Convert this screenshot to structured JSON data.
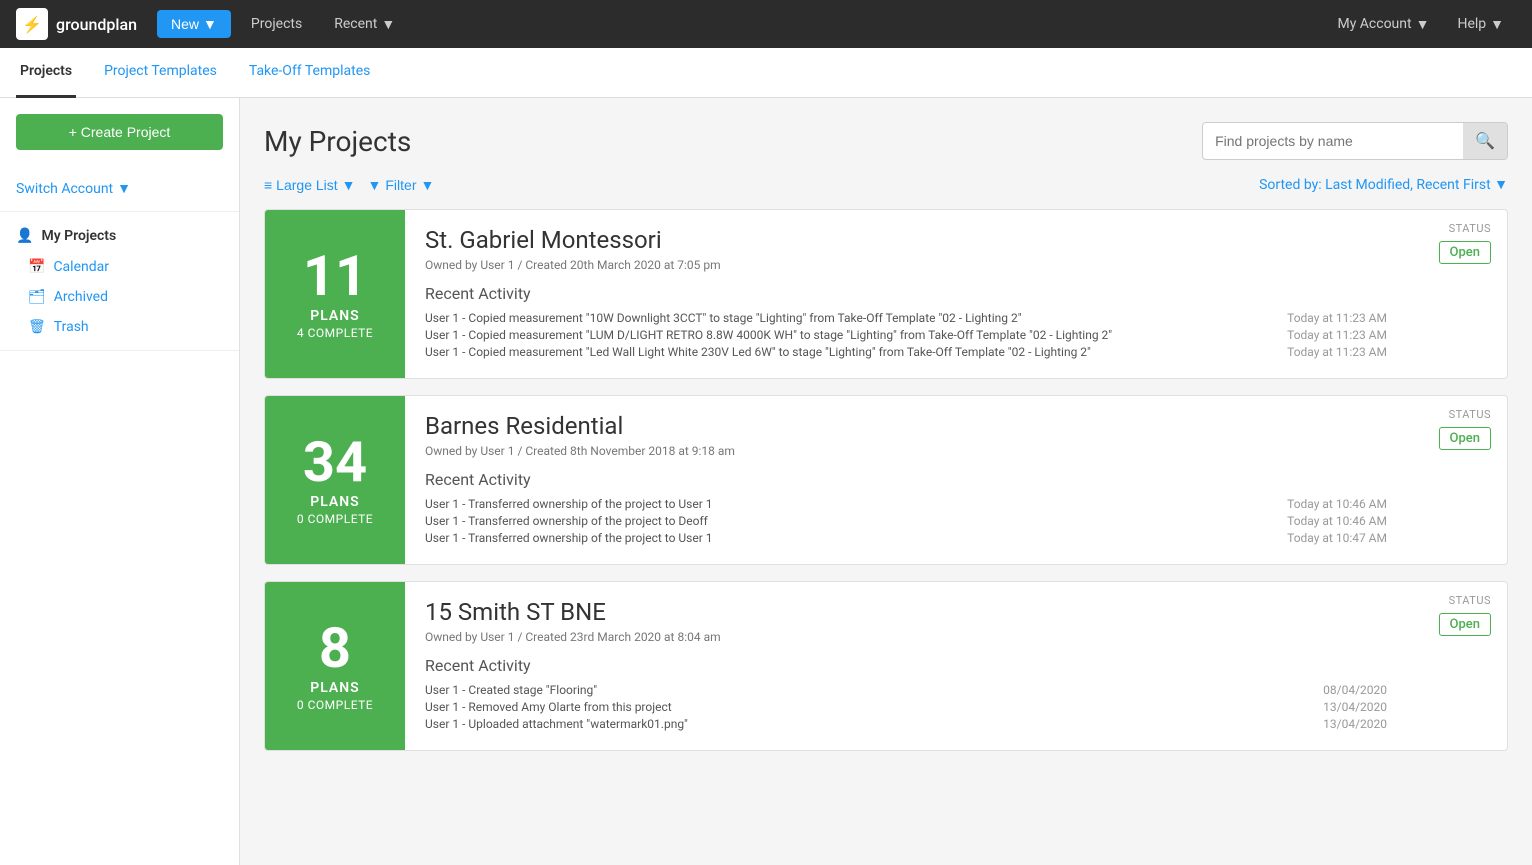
{
  "topNav": {
    "logo": "groundplan",
    "logoIcon": "⚡",
    "newLabel": "New",
    "newDropdown": true,
    "navLinks": [
      {
        "label": "Projects",
        "dropdown": false
      },
      {
        "label": "Recent",
        "dropdown": true
      }
    ],
    "rightLinks": [
      {
        "label": "My Account",
        "dropdown": true
      },
      {
        "label": "Help",
        "dropdown": true
      }
    ]
  },
  "subNav": {
    "tabs": [
      {
        "label": "Projects",
        "active": true
      },
      {
        "label": "Project Templates",
        "active": false
      },
      {
        "label": "Take-Off Templates",
        "active": false
      }
    ]
  },
  "sidebar": {
    "createButton": "+ Create Project",
    "switchAccount": "Switch Account",
    "myProjects": "My Projects",
    "items": [
      {
        "label": "Calendar",
        "icon": "📅"
      },
      {
        "label": "Archived",
        "icon": "🗂"
      },
      {
        "label": "Trash",
        "icon": "🗑"
      }
    ]
  },
  "main": {
    "title": "My Projects",
    "search": {
      "placeholder": "Find projects by name"
    },
    "toolbar": {
      "viewLabel": "Large List",
      "filterLabel": "Filter",
      "sortedBy": "Sorted by:",
      "sortValue": "Last Modified, Recent First"
    },
    "projects": [
      {
        "id": 1,
        "badgeNumber": "11",
        "badgePlans": "PLANS",
        "badgeComplete": "4 COMPLETE",
        "name": "St. Gabriel Montessori",
        "meta": "Owned by User 1 / Created 20th March 2020 at 7:05 pm",
        "activityTitle": "Recent Activity",
        "activities": [
          {
            "text": "User 1 - Copied measurement \"10W Downlight 3CCT\" to stage \"Lighting\" from Take-Off Template \"02 - Lighting 2\"",
            "time": "Today at 11:23 AM"
          },
          {
            "text": "User 1 - Copied measurement \"LUM D/LIGHT RETRO 8.8W 4000K WH\" to stage \"Lighting\" from Take-Off Template \"02 - Lighting 2\"",
            "time": "Today at 11:23 AM"
          },
          {
            "text": "User 1 - Copied measurement \"Led Wall Light White 230V Led 6W\" to stage \"Lighting\" from Take-Off Template \"02 - Lighting 2\"",
            "time": "Today at 11:23 AM"
          }
        ],
        "status": "Open"
      },
      {
        "id": 2,
        "badgeNumber": "34",
        "badgePlans": "PLANS",
        "badgeComplete": "0 COMPLETE",
        "name": "Barnes Residential",
        "meta": "Owned by User 1 / Created 8th November 2018 at 9:18 am",
        "activityTitle": "Recent Activity",
        "activities": [
          {
            "text": "User 1 - Transferred ownership of the project to User 1",
            "time": "Today at 10:46 AM"
          },
          {
            "text": "User 1 - Transferred ownership of the project to Deoff",
            "time": "Today at 10:46 AM"
          },
          {
            "text": "User 1 - Transferred ownership of the project to User 1",
            "time": "Today at 10:47 AM"
          }
        ],
        "status": "Open"
      },
      {
        "id": 3,
        "badgeNumber": "8",
        "badgePlans": "PLANS",
        "badgeComplete": "0 COMPLETE",
        "name": "15 Smith ST BNE",
        "meta": "Owned by User 1 / Created 23rd March 2020 at 8:04 am",
        "activityTitle": "Recent Activity",
        "activities": [
          {
            "text": "User 1 - Created stage \"Flooring\"",
            "time": "08/04/2020"
          },
          {
            "text": "User 1 - Removed Amy Olarte from this project",
            "time": "13/04/2020"
          },
          {
            "text": "User 1 - Uploaded attachment \"watermark01.png\"",
            "time": "13/04/2020"
          }
        ],
        "status": "Open"
      }
    ]
  }
}
